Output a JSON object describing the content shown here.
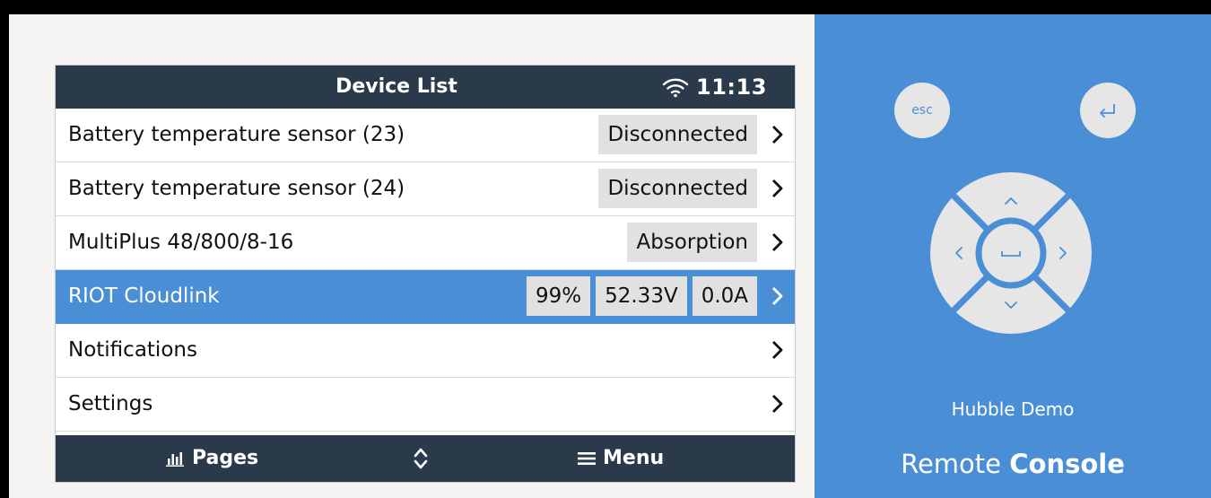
{
  "header": {
    "title": "Device List",
    "time": "11:13"
  },
  "rows": [
    {
      "label": "Battery temperature sensor (23)",
      "values": [
        "Disconnected"
      ]
    },
    {
      "label": "Battery temperature sensor (24)",
      "values": [
        "Disconnected"
      ]
    },
    {
      "label": "MultiPlus 48/800/8-16",
      "values": [
        "Absorption"
      ]
    },
    {
      "label": "RIOT Cloudlink",
      "values": [
        "99%",
        "52.33V",
        "0.0A"
      ],
      "selected": true
    },
    {
      "label": "Notifications",
      "values": []
    },
    {
      "label": "Settings",
      "values": []
    }
  ],
  "footer": {
    "pages_label": "Pages",
    "menu_label": "Menu"
  },
  "remote": {
    "esc_label": "esc",
    "device_name": "Hubble Demo",
    "brand_light": "Remote",
    "brand_bold": "Console"
  },
  "colors": {
    "accent": "#4a8fd6",
    "dark_bar": "#2b3a4a",
    "pill": "#e1e1e1"
  },
  "icons": [
    "wifi-icon",
    "chevron-right-icon",
    "bar-chart-icon",
    "up-down-icon",
    "hamburger-icon",
    "enter-icon",
    "arrow-up-icon",
    "arrow-down-icon",
    "arrow-left-icon",
    "arrow-right-icon",
    "space-icon"
  ]
}
